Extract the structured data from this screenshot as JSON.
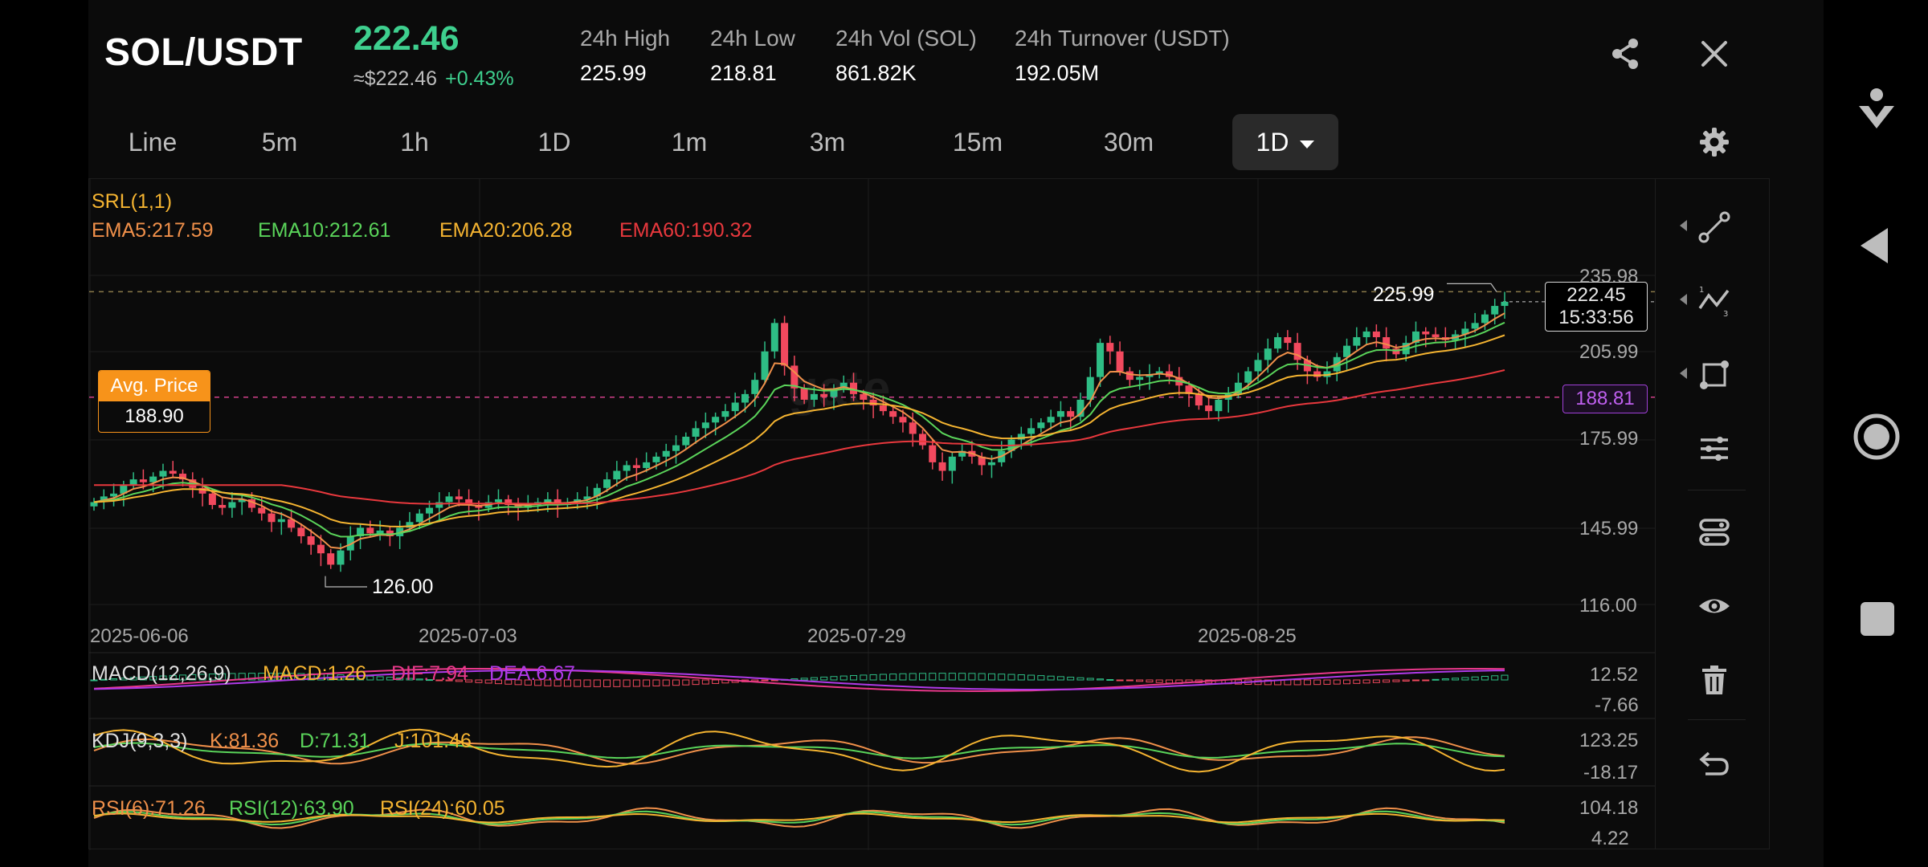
{
  "header": {
    "pair": "SOL/USDT",
    "price": "222.46",
    "price_fiat": "≈$222.46",
    "change": "+0.43%",
    "stats": [
      {
        "label": "24h High",
        "value": "225.99"
      },
      {
        "label": "24h Low",
        "value": "218.81"
      },
      {
        "label": "24h Vol (SOL)",
        "value": "861.82K"
      },
      {
        "label": "24h Turnover (USDT)",
        "value": "192.05M"
      }
    ],
    "share_icon": "share-icon",
    "close_icon": "close-icon"
  },
  "tabs": {
    "items": [
      "Line",
      "5m",
      "1h",
      "1D",
      "1m",
      "3m",
      "15m",
      "30m"
    ],
    "active_label": "1D",
    "settings_icon": "gear-icon"
  },
  "chart": {
    "srl": "SRL(1,1)",
    "ema": [
      {
        "text": "EMA5:217.59",
        "color": "#f0904a"
      },
      {
        "text": "EMA10:212.61",
        "color": "#5ad45a"
      },
      {
        "text": "EMA20:206.28",
        "color": "#f5b431"
      },
      {
        "text": "EMA60:190.32",
        "color": "#e8383d"
      }
    ],
    "watermark": "gate",
    "price_ticks": [
      "235.98",
      "205.99",
      "175.99",
      "145.99",
      "116.00"
    ],
    "high_marker": "225.99",
    "low_marker": "126.00",
    "current_price": "222.45",
    "countdown": "15:33:56",
    "avg_price_label": "Avg. Price",
    "avg_price": "188.90",
    "avg_price_tag": "188.81",
    "date_labels": [
      "2025-06-06",
      "2025-07-03",
      "2025-07-29",
      "2025-08-25"
    ],
    "macd": {
      "title": "MACD(12,26,9)",
      "items": [
        {
          "text": "MACD:1.26",
          "color": "#f5b431"
        },
        {
          "text": "DIF:7.94",
          "color": "#e8388a"
        },
        {
          "text": "DEA:6.67",
          "color": "#b03ae8"
        }
      ],
      "ticks": [
        "12.52",
        "-7.66"
      ]
    },
    "kdj": {
      "title": "KDJ(9,3,3)",
      "items": [
        {
          "text": "K:81.36",
          "color": "#f0904a"
        },
        {
          "text": "D:71.31",
          "color": "#5ad45a"
        },
        {
          "text": "J:101.46",
          "color": "#f5b431"
        }
      ],
      "ticks": [
        "123.25",
        "-18.17"
      ]
    },
    "rsi": {
      "items": [
        {
          "text": "RSI(6):71.26",
          "color": "#f0904a"
        },
        {
          "text": "RSI(12):63.90",
          "color": "#5ad45a"
        },
        {
          "text": "RSI(24):60.05",
          "color": "#f5b431"
        }
      ],
      "ticks": [
        "104.18",
        "4.22"
      ]
    },
    "colors": {
      "up": "#2ebd85",
      "down": "#f2495e",
      "grid": "#1c1c1c",
      "avg": "#f7931a",
      "avg_tag": "#a040d8"
    }
  },
  "toolbar_icons": [
    "trend-line-icon",
    "fib-line-icon",
    "rectangle-icon",
    "indicators-icon",
    "strategies-icon",
    "eye-icon",
    "trash-icon",
    "undo-icon"
  ],
  "system_icons": [
    "download-icon",
    "back-icon",
    "home-icon",
    "recents-icon"
  ],
  "chart_data": {
    "type": "candlestick",
    "title": "",
    "x": [
      "2025-06-06",
      "2025-07-03",
      "2025-07-29",
      "2025-08-25"
    ],
    "ylim": [
      116.0,
      235.98
    ],
    "high": 225.99,
    "low": 126.0,
    "last": 222.45,
    "avg_price": 188.9,
    "closes": [
      152,
      154,
      155,
      158,
      160,
      159,
      161,
      163,
      162,
      160,
      157,
      155,
      151,
      150,
      152,
      153,
      150,
      148,
      145,
      146,
      143,
      140,
      137,
      134,
      130,
      135,
      140,
      143,
      141,
      142,
      140,
      143,
      145,
      148,
      150,
      152,
      154,
      153,
      151,
      150,
      152,
      153,
      151,
      150,
      151,
      152,
      153,
      151,
      152,
      153,
      154,
      157,
      160,
      163,
      165,
      164,
      166,
      168,
      170,
      172,
      175,
      178,
      180,
      182,
      184,
      187,
      190,
      195,
      205,
      215,
      200,
      192,
      188,
      190,
      189,
      192,
      194,
      190,
      188,
      186,
      184,
      182,
      180,
      176,
      172,
      166,
      163,
      168,
      170,
      168,
      165,
      166,
      170,
      174,
      176,
      178,
      180,
      182,
      184,
      182,
      188,
      196,
      208,
      205,
      198,
      195,
      196,
      197,
      198,
      196,
      193,
      190,
      186,
      184,
      188,
      190,
      194,
      198,
      202,
      206,
      210,
      208,
      202,
      198,
      196,
      198,
      203,
      207,
      210,
      212,
      210,
      206,
      204,
      208,
      212,
      211,
      210,
      209,
      211,
      213,
      215,
      218,
      221,
      222.45
    ],
    "series": [
      {
        "name": "EMA5",
        "last": 217.59
      },
      {
        "name": "EMA10",
        "last": 212.61
      },
      {
        "name": "EMA20",
        "last": 206.28
      },
      {
        "name": "EMA60",
        "last": 190.32
      }
    ],
    "indicators": {
      "MACD": {
        "MACD": 1.26,
        "DIF": 7.94,
        "DEA": 6.67,
        "ylim": [
          -7.66,
          12.52
        ]
      },
      "KDJ": {
        "K": 81.36,
        "D": 71.31,
        "J": 101.46,
        "ylim": [
          -18.17,
          123.25
        ]
      },
      "RSI": {
        "RSI6": 71.26,
        "RSI12": 63.9,
        "RSI24": 60.05,
        "ylim": [
          4.22,
          104.18
        ]
      }
    }
  }
}
